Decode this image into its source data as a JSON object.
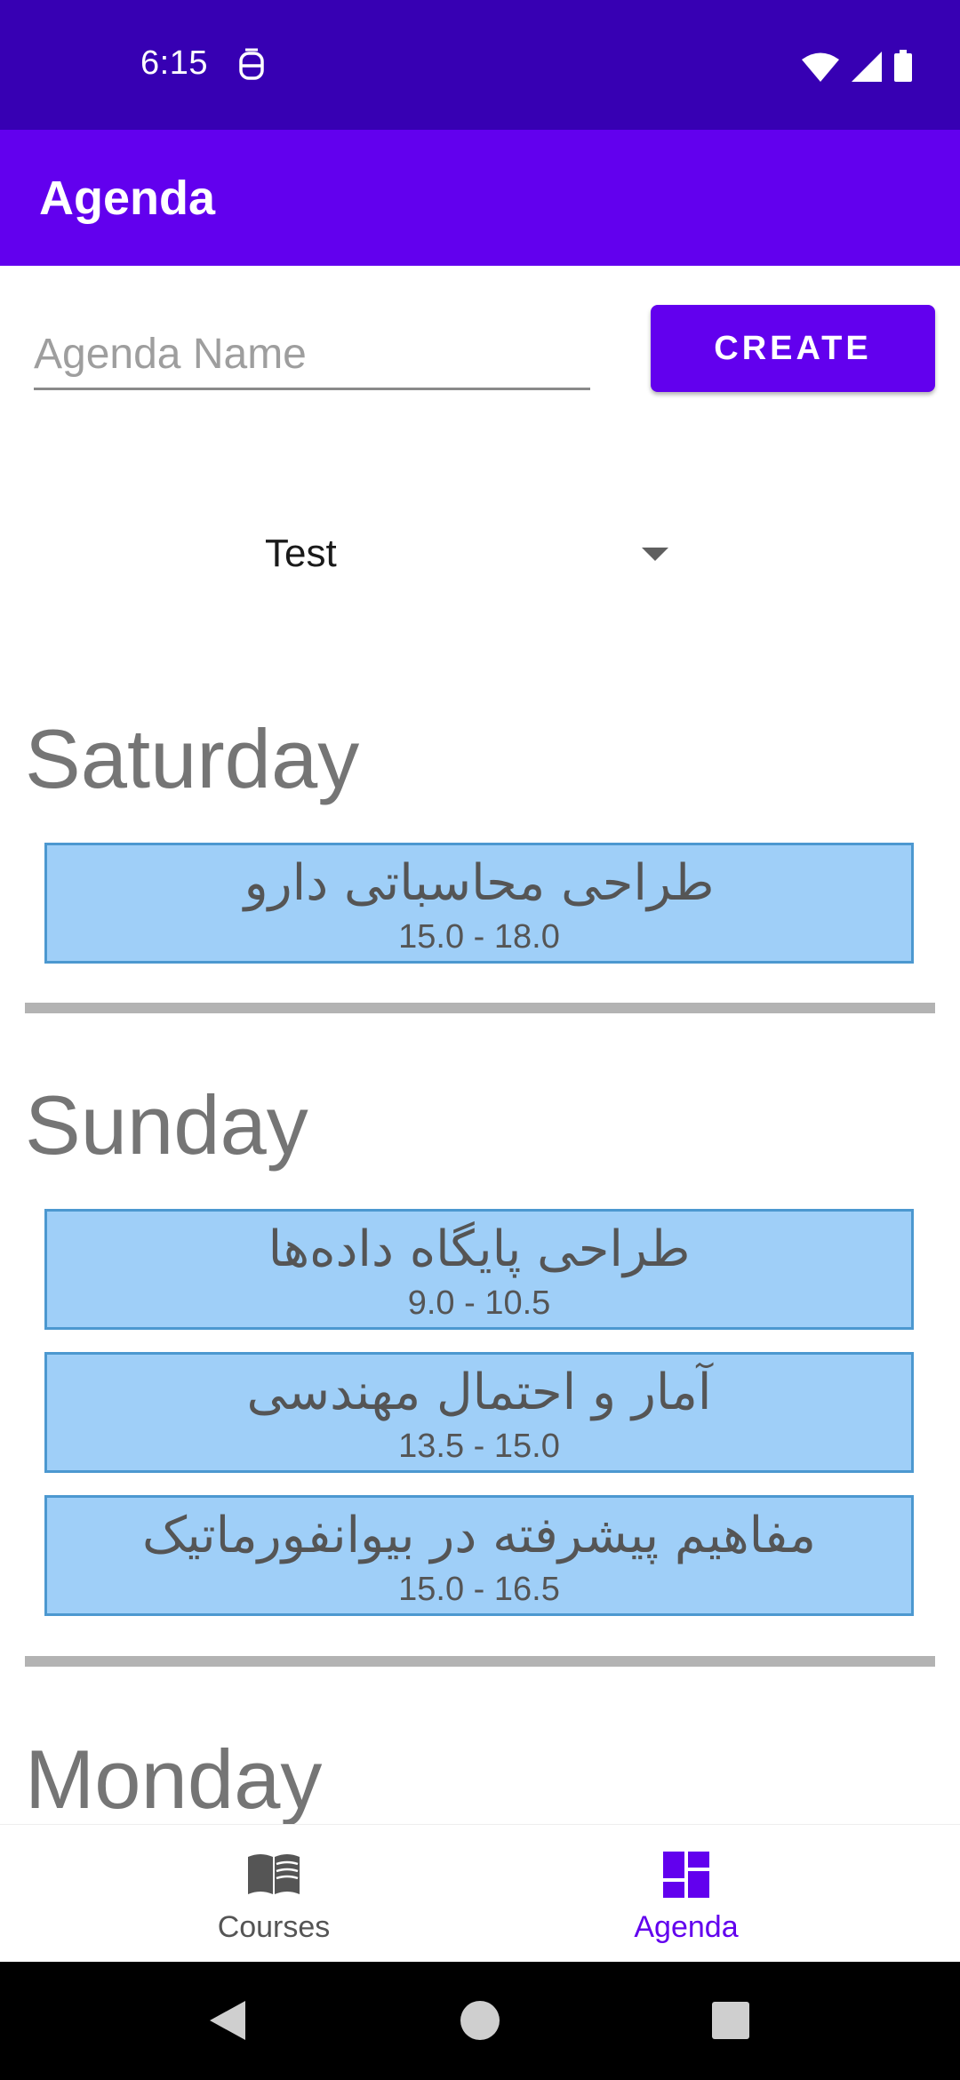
{
  "status_bar": {
    "time": "6:15"
  },
  "app_bar": {
    "title": "Agenda"
  },
  "form": {
    "agenda_name_placeholder": "Agenda Name",
    "create_label": "CREATE"
  },
  "spinner": {
    "selected": "Test"
  },
  "days": [
    {
      "name": "Saturday",
      "courses": [
        {
          "name": "طراحی محاسباتی دارو",
          "time": "15.0 - 18.0"
        }
      ]
    },
    {
      "name": "Sunday",
      "courses": [
        {
          "name": "طراحی پایگاه داده‌ها",
          "time": "9.0 - 10.5"
        },
        {
          "name": "آمار و احتمال مهندسی",
          "time": "13.5 - 15.0"
        },
        {
          "name": "مفاهیم پیشرفته در بیوانفورماتیک",
          "time": "15.0 - 16.5"
        }
      ]
    },
    {
      "name": "Monday",
      "courses": []
    }
  ],
  "bottom_nav": {
    "items": [
      {
        "label": "Courses",
        "icon": "book-icon",
        "active": false
      },
      {
        "label": "Agenda",
        "icon": "dashboard-icon",
        "active": true
      }
    ]
  },
  "colors": {
    "status_bar": "#3700b3",
    "app_bar": "#6200ee",
    "accent": "#6200ee",
    "card_fill": "#9fcff8",
    "card_border": "#4c98d0",
    "day_heading": "#757575",
    "divider": "#b3b3b3",
    "nav_inactive": "#555555"
  }
}
